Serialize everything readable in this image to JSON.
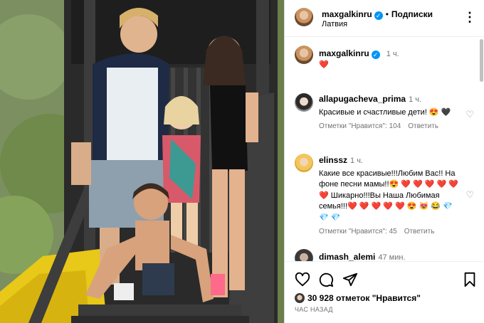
{
  "post": {
    "author": "maxgalkinru",
    "verified_mark": "✓",
    "follow_label": "Подписки",
    "location": "Латвия",
    "caption_time": "1 ч.",
    "caption_emoji": "❤️"
  },
  "comments": [
    {
      "user": "allapugacheva_prima",
      "time": "1 ч.",
      "text": "Красивые и счастливые дети! 😍 🖤",
      "likes_label": "Отметки \"Нравится\": 104",
      "reply_label": "Ответить"
    },
    {
      "user": "elinssz",
      "time": "1 ч.",
      "text": "Какие все красивые!!!Любим Вас!! На фоне песни мамы!!😍 ❤️ ❤️ ❤️ ❤️ ❤️ ❤️ Шикарно!!!Вы Наша Любимая семья!!!❤️ ❤️ ❤️ ❤️ ❤️ 😍 😻 😂 💎 💎 💎",
      "likes_label": "Отметки \"Нравится\": 45",
      "reply_label": "Ответить"
    },
    {
      "user": "dimash_alemi",
      "time": "47 мин.",
      "text": "",
      "likes_label": "",
      "reply_label": ""
    }
  ],
  "footer": {
    "likes_text": "30 928 отметок \"Нравится\"",
    "time_ago": "ЧАС НАЗАД"
  },
  "icons": [
    "more-icon",
    "heart-icon",
    "comment-icon",
    "share-icon",
    "bookmark-icon",
    "verified-icon"
  ],
  "colors": {
    "verified": "#0095f6",
    "heart": "#ed4956",
    "muted": "#737373",
    "border": "#dbdbdb"
  }
}
